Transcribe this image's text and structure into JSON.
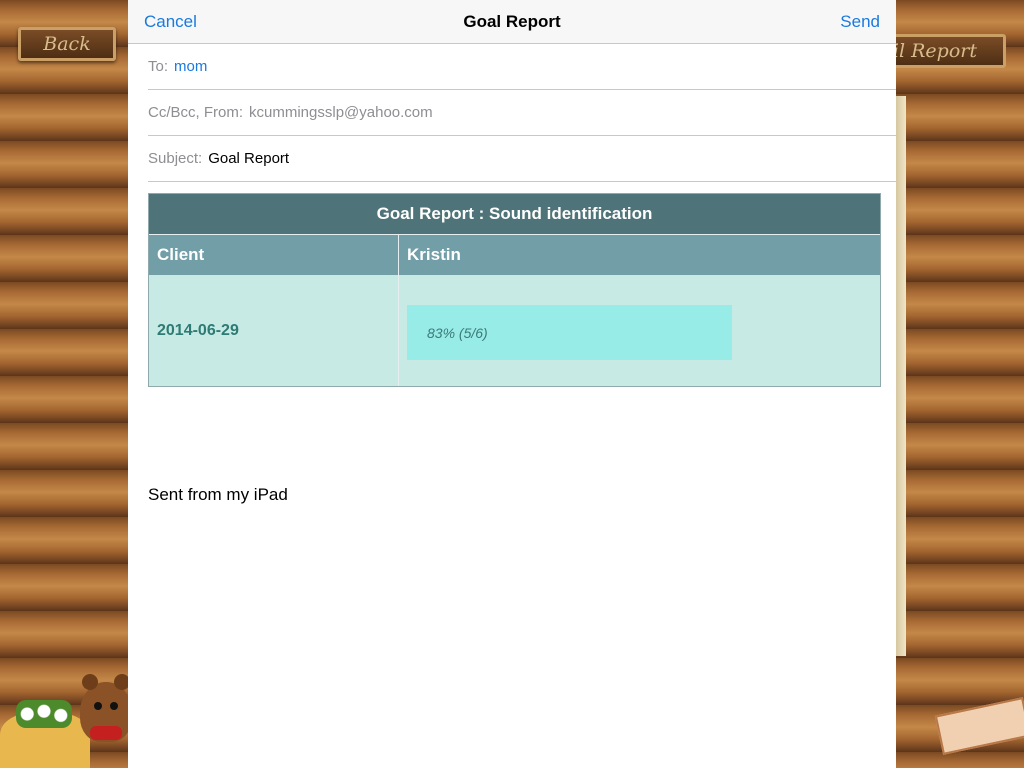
{
  "background": {
    "back_label": "Back",
    "email_report_label": "Email Report"
  },
  "compose": {
    "cancel_label": "Cancel",
    "title": "Goal Report",
    "send_label": "Send",
    "to_label": "To:",
    "to_value": "mom",
    "ccbcc_label": "Cc/Bcc, From:",
    "from_value": "kcummingsslp@yahoo.com",
    "subject_label": "Subject:",
    "subject_value": "Goal Report"
  },
  "report": {
    "title": "Goal Report : Sound identification",
    "header_client": "Client",
    "header_name": "Kristin",
    "rows": [
      {
        "date": "2014-06-29",
        "progress_text": "83% (5/6)",
        "progress_fraction": 0.83
      }
    ]
  },
  "signature": "Sent from my iPad",
  "colors": {
    "link_blue": "#1a7ae0",
    "report_title_bg": "#4e7378",
    "report_header_bg": "#729ea8",
    "report_row_bg": "#c7ebe4",
    "progress_fill": "#98ece8"
  }
}
